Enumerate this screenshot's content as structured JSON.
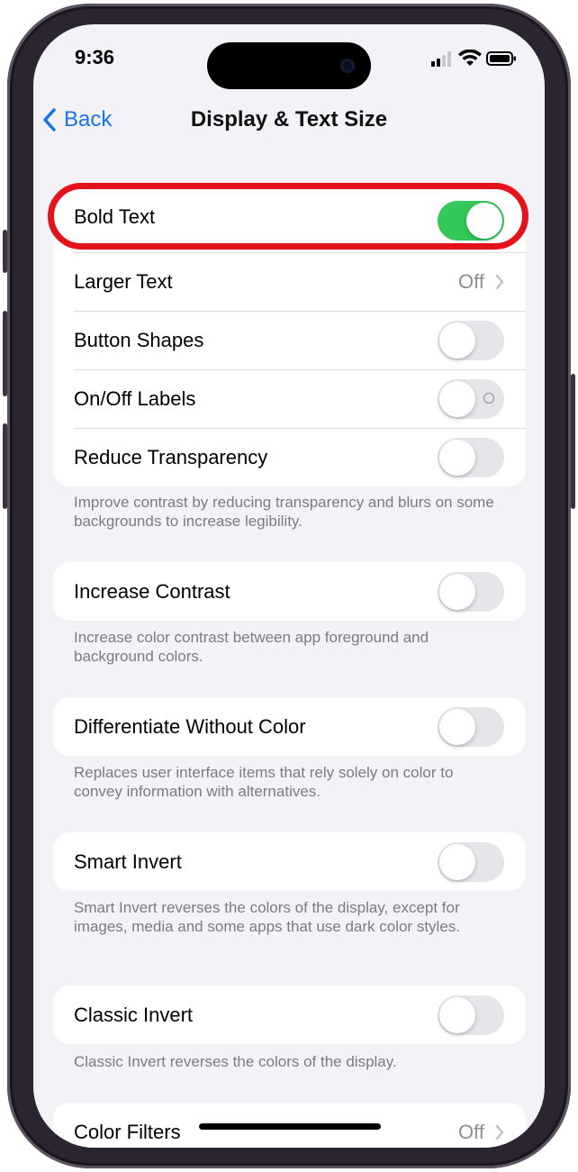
{
  "status_bar": {
    "time": "9:36"
  },
  "nav": {
    "back_label": "Back",
    "title": "Display & Text Size"
  },
  "group1": {
    "bold_text": {
      "label": "Bold Text",
      "state": "on"
    },
    "larger_text": {
      "label": "Larger Text",
      "value": "Off"
    },
    "button_shapes": {
      "label": "Button Shapes",
      "state": "off"
    },
    "on_off_labels": {
      "label": "On/Off Labels",
      "state": "off"
    },
    "reduce_transparency": {
      "label": "Reduce Transparency",
      "state": "off"
    },
    "footnote": "Improve contrast by reducing transparency and blurs on some backgrounds to increase legibility."
  },
  "increase_contrast": {
    "label": "Increase Contrast",
    "state": "off",
    "footnote": "Increase color contrast between app foreground and background colors."
  },
  "differentiate": {
    "label": "Differentiate Without Color",
    "state": "off",
    "footnote": "Replaces user interface items that rely solely on color to convey information with alternatives."
  },
  "smart_invert": {
    "label": "Smart Invert",
    "state": "off",
    "footnote": "Smart Invert reverses the colors of the display, except for images, media and some apps that use dark color styles."
  },
  "classic_invert": {
    "label": "Classic Invert",
    "state": "off",
    "footnote": "Classic Invert reverses the colors of the display."
  },
  "color_filters": {
    "label": "Color Filters",
    "value": "Off"
  },
  "colors": {
    "accent": "#1a73e8",
    "toggle_on": "#34c759",
    "highlight": "#e4121a"
  },
  "icons": [
    "chevron-left-icon",
    "cellular-signal-icon",
    "wifi-icon",
    "battery-icon",
    "chevron-right-icon"
  ]
}
